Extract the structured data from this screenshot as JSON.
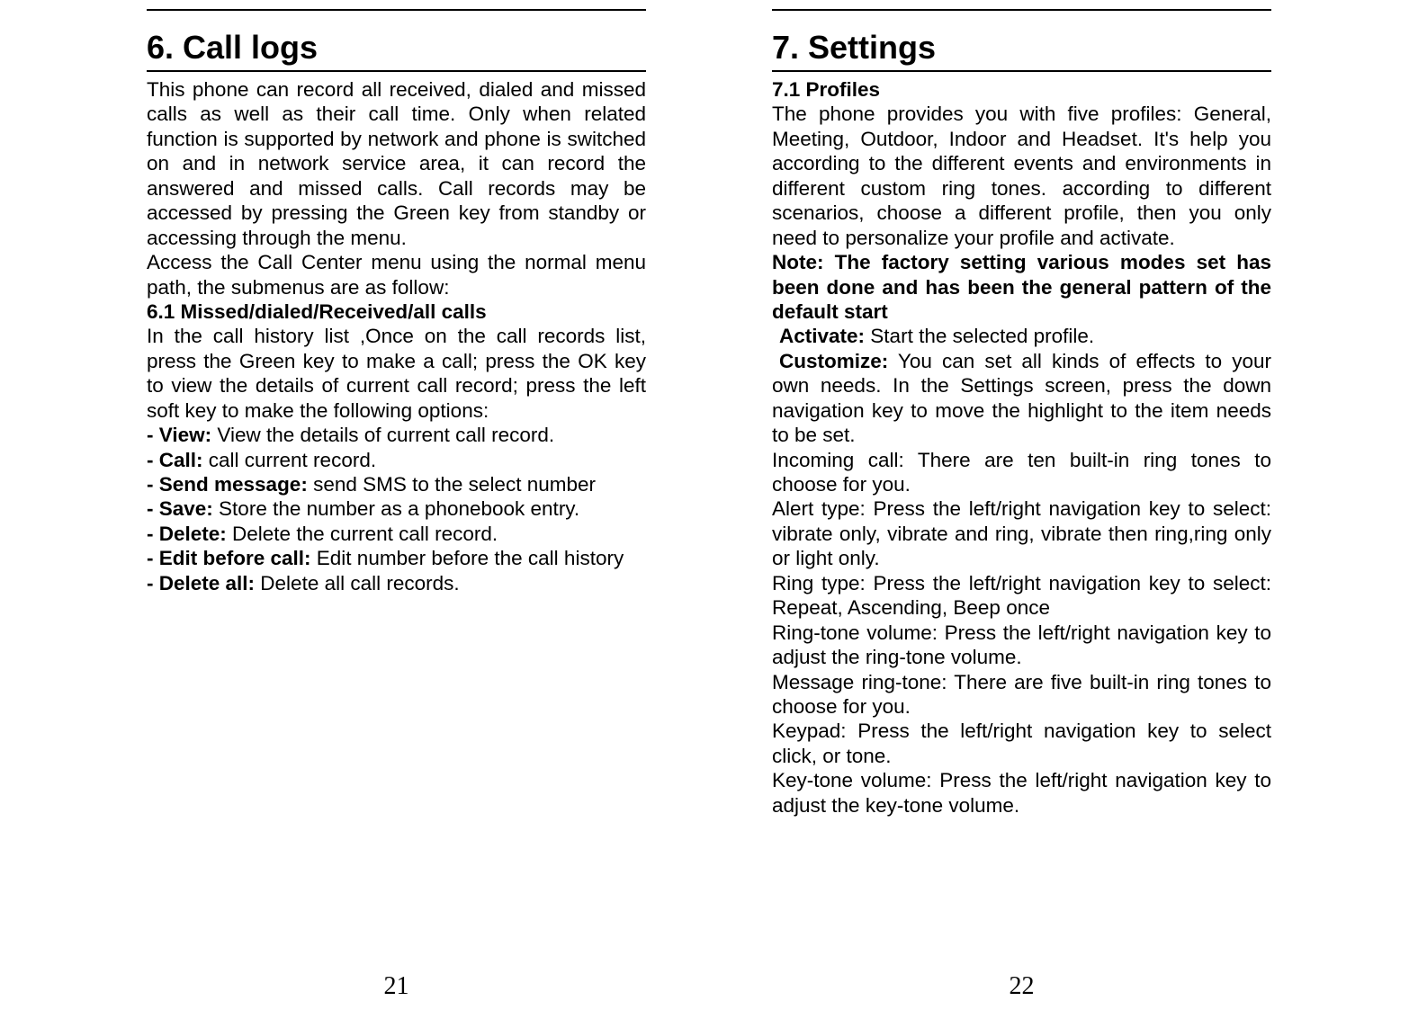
{
  "left": {
    "heading": "6.    Call logs",
    "intro": "This phone can record all received, dialed and missed calls as well as their call time. Only when related function is supported by network and phone is switched on and in network service area, it can record the answered and missed calls. Call records may be accessed by pressing the Green key from standby or accessing through the menu.",
    "access": "Access the Call Center menu using the normal menu path, the submenus are as follow:",
    "sub61": "6.1 Missed/dialed/Received/all calls",
    "history": "In the call history list ,Once on the call records list, press the Green key to make a call; press the OK key to view the details of current call record; press the left soft key to make the following options:",
    "options": [
      {
        "label": "- View:",
        "text": " View the details of current call record."
      },
      {
        "label": "- Call:",
        "text": " call current record."
      },
      {
        "label": "- Send message:",
        "text": " send SMS to the select number"
      },
      {
        "label": "- Save:",
        "text": " Store the number as a phonebook entry."
      },
      {
        "label": "- Delete:",
        "text": " Delete the current call record."
      },
      {
        "label": "- Edit before call:",
        "text": " Edit number before the call history"
      },
      {
        "label": "- Delete all:",
        "text": " Delete all call records."
      }
    ],
    "page_number": "21"
  },
  "right": {
    "heading": "7.    Settings",
    "sub71": "7.1 Profiles",
    "profiles_intro": "The phone provides you with five profiles: General, Meeting, Outdoor, Indoor and Headset. It's help you according to the different events and environments in different custom ring tones. according to different scenarios, choose a different profile, then you only need to personalize your profile and activate.",
    "note": "Note: The factory setting various modes set has been done and has been the general pattern of the default start",
    "activate_label": "Activate:",
    "activate_text": " Start the selected profile.",
    "customize_label": "Customize:",
    "customize_text": " You can set all kinds of effects to your own needs.  In the Settings screen, press the down navigation key to move the highlight to the item needs to be set.",
    "incoming": "Incoming call: There are ten built-in ring tones to choose for you.",
    "alert": "Alert type: Press the left/right navigation key to select: vibrate only, vibrate and ring, vibrate then ring,ring only or light only.",
    "ringtype": "Ring type: Press the left/right navigation key to select: Repeat, Ascending, Beep once",
    "ringvol": "Ring-tone volume: Press the left/right navigation key to adjust the ring-tone volume.",
    "msgring": "Message ring-tone: There are five built-in ring tones to choose for you.",
    "keypad": "Keypad: Press the left/right navigation key to select click, or tone.",
    "keyvol": "Key-tone volume: Press the left/right navigation key to adjust the key-tone volume.",
    "page_number": "22"
  }
}
